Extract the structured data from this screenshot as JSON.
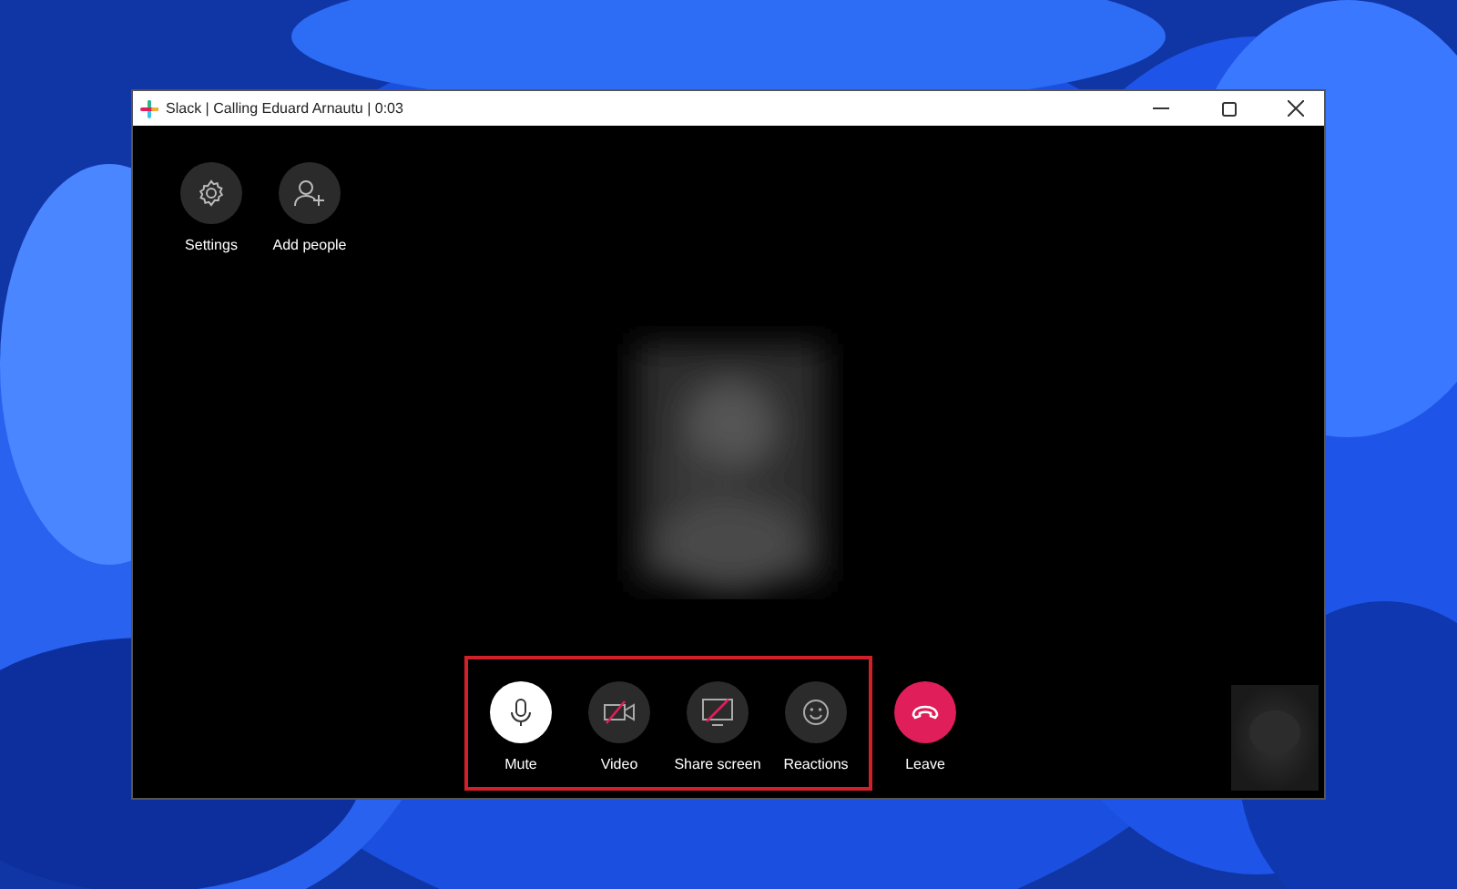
{
  "window": {
    "title": "Slack | Calling Eduard Arnautu | 0:03"
  },
  "top_actions": [
    {
      "kind": "settings",
      "label": "Settings"
    },
    {
      "kind": "add_people",
      "label": "Add people"
    }
  ],
  "call_controls": [
    {
      "kind": "mute",
      "label": "Mute",
      "active": true,
      "highlighted": true
    },
    {
      "kind": "video",
      "label": "Video",
      "active": false,
      "highlighted": true
    },
    {
      "kind": "share",
      "label": "Share screen",
      "active": false,
      "highlighted": true
    },
    {
      "kind": "reactions",
      "label": "Reactions",
      "active": false,
      "highlighted": true
    },
    {
      "kind": "leave",
      "label": "Leave",
      "highlighted": false
    }
  ]
}
